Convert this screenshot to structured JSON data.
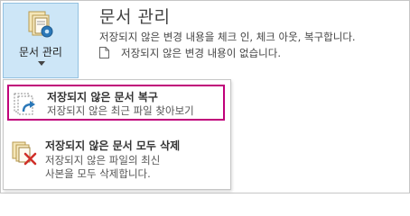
{
  "manage": {
    "button_label": "문서 관리",
    "title": "문서 관리",
    "description": "저장되지 않은 변경 내용을 체크 인, 체크 아웃, 복구합니다.",
    "status": "저장되지 않은 변경 내용이 없습니다."
  },
  "menu": {
    "items": [
      {
        "label": "저장되지 않은 문서 복구",
        "description": "저장되지 않은 최근 파일 찾아보기"
      },
      {
        "label": "저장되지 않은 문서 모두 삭제",
        "description_line1": "저장되지 않은 파일의 최신",
        "description_line2": "사본을 모두 삭제합니다."
      }
    ]
  },
  "colors": {
    "button_bg": "#cde6f7",
    "highlight_border": "#c0007a"
  }
}
